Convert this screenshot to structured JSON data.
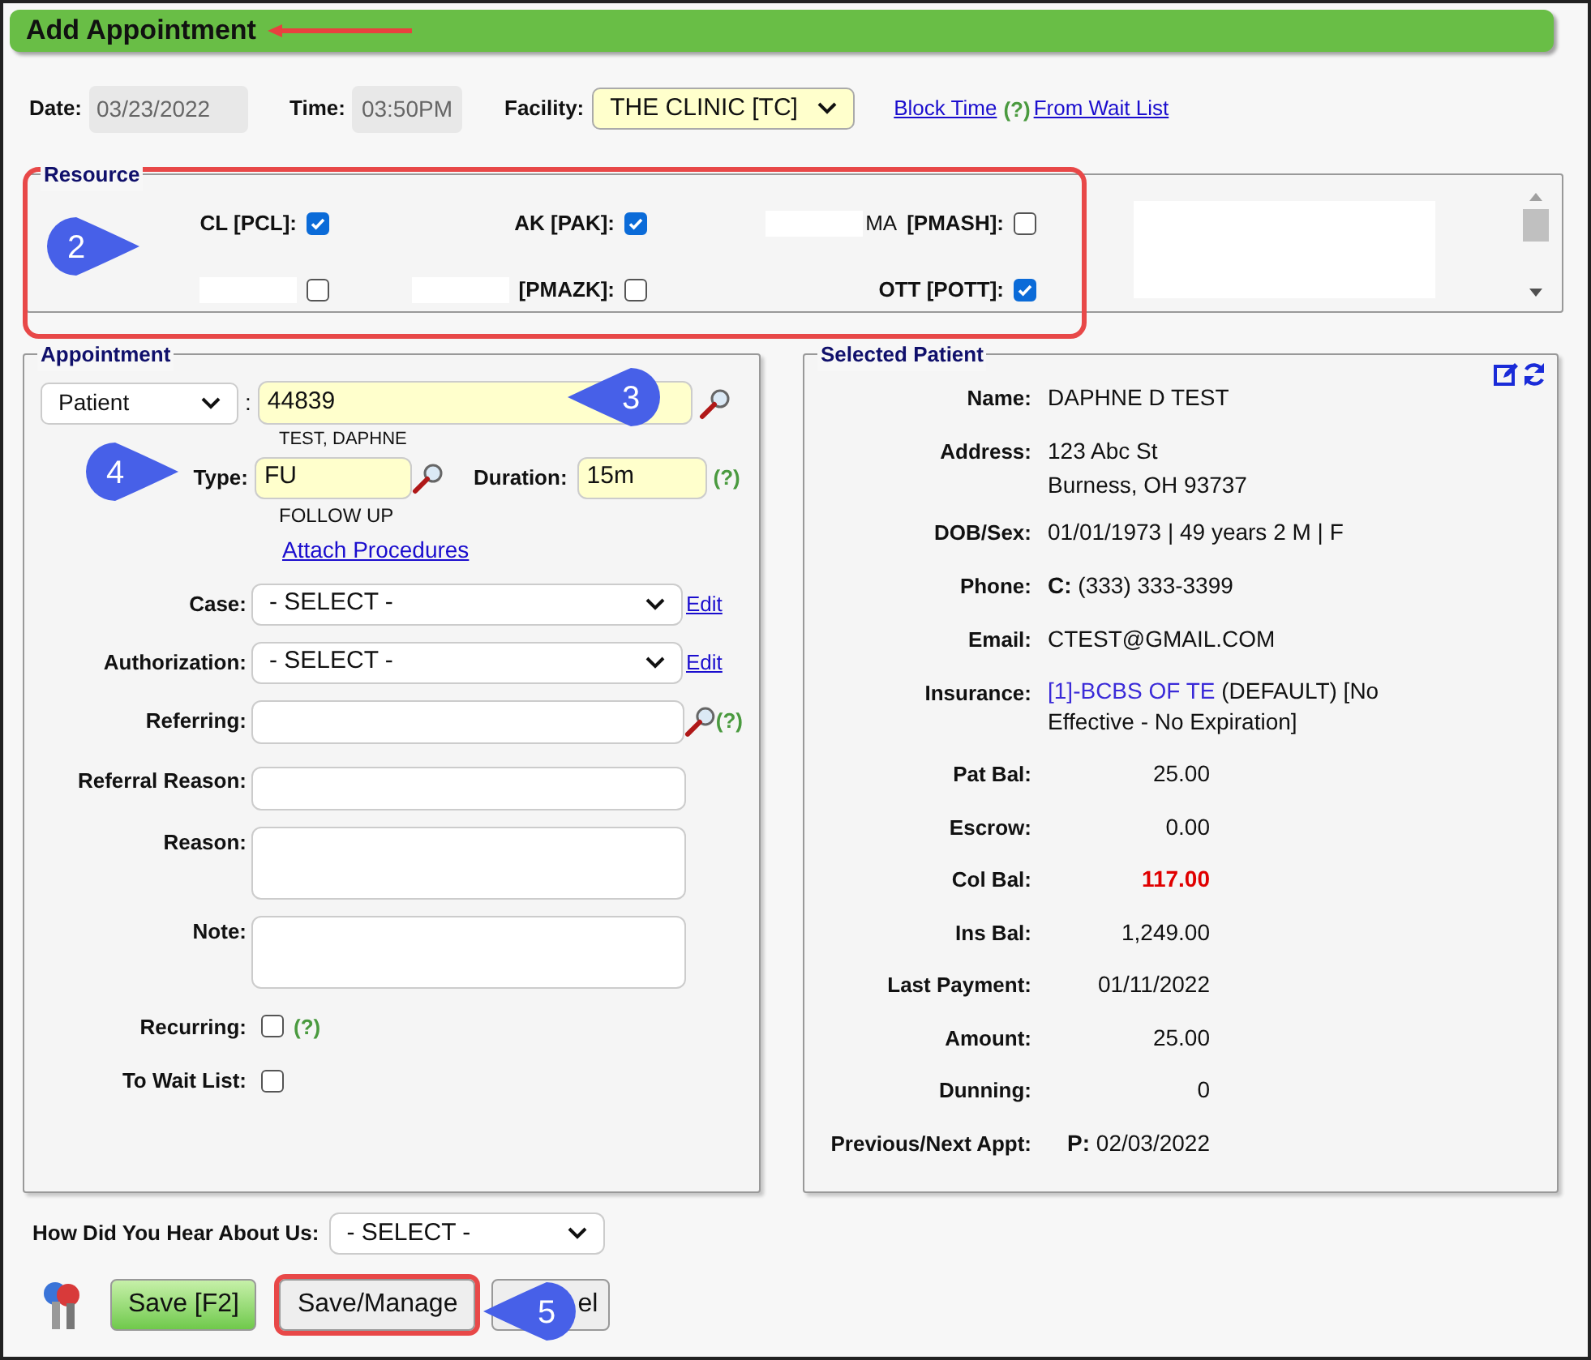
{
  "title": "Add Appointment",
  "top": {
    "date_label": "Date:",
    "date": "03/23/2022",
    "time_label": "Time:",
    "time": "03:50PM",
    "facility_label": "Facility:",
    "facility": "THE CLINIC [TC]",
    "links": [
      "Block Time",
      "From Wait List"
    ],
    "help": "(?)"
  },
  "resource": {
    "legend": "Resource",
    "items": [
      {
        "label": "CL [PCL]:",
        "redacted": false,
        "checked": true
      },
      {
        "label": "AK [PAK]:",
        "redacted": false,
        "checked": true
      },
      {
        "prefix": "MA",
        "label": "[PMASH]:",
        "redacted": true,
        "checked": false
      },
      {
        "redacted": true,
        "checked": false
      },
      {
        "label": "[PMAZK]:",
        "redacted": true,
        "checked": false
      },
      {
        "label": "OTT [POTT]:",
        "redacted": false,
        "checked": true
      }
    ]
  },
  "appointment": {
    "legend": "Appointment",
    "lookup_kind": "Patient",
    "separator": ":",
    "patient_id": "44839",
    "patient_name": "TEST, DAPHNE",
    "type_label": "Type:",
    "type": "FU",
    "type_name": "FOLLOW UP",
    "duration_label": "Duration:",
    "duration": "15m",
    "help": "(?)",
    "attach": "Attach Procedures",
    "fields": [
      {
        "kind": "select",
        "label": "Case:",
        "value": "- SELECT -",
        "link": "Edit"
      },
      {
        "kind": "select",
        "label": "Authorization:",
        "value": "- SELECT -",
        "link": "Edit"
      },
      {
        "kind": "lookup",
        "label": "Referring:",
        "help": "(?)"
      },
      {
        "kind": "input",
        "label": "Referral Reason:"
      },
      {
        "kind": "textarea",
        "label": "Reason:"
      },
      {
        "kind": "textarea",
        "label": "Note:"
      },
      {
        "kind": "checkbox",
        "label": "Recurring:",
        "checked": false,
        "help": "(?)"
      },
      {
        "kind": "checkbox",
        "label": "To Wait List:",
        "checked": false
      }
    ]
  },
  "patient": {
    "legend": "Selected Patient",
    "rows": [
      {
        "kind": "text",
        "label": "Name:",
        "value": "DAPHNE D TEST"
      },
      {
        "kind": "text",
        "label": "Address:",
        "value": "123 Abc St",
        "value2": "Burness, OH 93737"
      },
      {
        "kind": "text",
        "label": "DOB/Sex:",
        "value": "01/01/1973 | 49 years 2 M | F"
      },
      {
        "kind": "text",
        "label": "Phone:",
        "value": "**C:** (333) 333-3399"
      },
      {
        "kind": "text",
        "label": "Email:",
        "value": "CTEST@GMAIL.COM"
      },
      {
        "kind": "insurance",
        "label": "Insurance:",
        "link": "[1]-BCBS OF TE",
        "value": "(DEFAULT) [No Effective - No Expiration]"
      },
      {
        "kind": "amount",
        "label": "Pat Bal:",
        "value": "25.00"
      },
      {
        "kind": "amount",
        "label": "Escrow:",
        "value": "0.00"
      },
      {
        "kind": "amount",
        "label": "Col Bal:",
        "value": "117.00",
        "alert": true
      },
      {
        "kind": "amount",
        "label": "Ins Bal:",
        "value": "1,249.00"
      },
      {
        "kind": "amount",
        "label": "Last Payment:",
        "value": "01/11/2022"
      },
      {
        "kind": "amount",
        "label": "Amount:",
        "value": "25.00"
      },
      {
        "kind": "amount",
        "label": "Dunning:",
        "value": "0"
      },
      {
        "kind": "amount",
        "label": "Previous/Next Appt:",
        "value": "**P:** 02/03/2022"
      }
    ]
  },
  "hear": {
    "label": "How Did You Hear About Us:",
    "value": "- SELECT -"
  },
  "buttons": [
    {
      "kind": "save",
      "label": "Save [F2]"
    },
    {
      "kind": "manage",
      "label": "Save/Manage",
      "highlighted": true
    },
    {
      "kind": "cancel",
      "label": "el"
    }
  ],
  "callouts": [
    "2",
    "3",
    "4",
    "5"
  ]
}
